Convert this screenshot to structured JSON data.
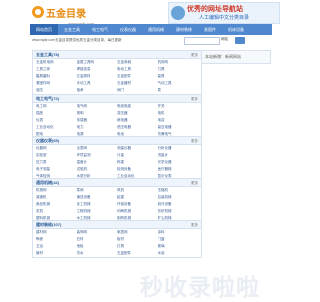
{
  "header": {
    "logo_text": "五金目录",
    "logo_url": "www.wjdir.com"
  },
  "banner": {
    "title": "优秀的网址导航站",
    "subtitle": "人工编辑中文分类目录"
  },
  "nav": {
    "items": [
      "网站首页",
      "五金工具",
      "电工电气",
      "仪表仪器",
      "通用机械",
      "建材装修",
      "紧固件",
      "机床设备"
    ]
  },
  "search": {
    "tip": "www.wjdir.com五金目录提供优质五金分类目录，每日更新",
    "placeholder": "",
    "select_value": "网站",
    "button_label": ""
  },
  "sidebar": {
    "text": "本站新增：新闻网站"
  },
  "sections": [
    {
      "title": "五金工具(78)",
      "more": "更多",
      "links": [
        "五金机电网",
        "金属工具网",
        "五金商城",
        "机床网",
        "工具之家",
        "焊接信息",
        "电动工具",
        "刀具",
        "磨具磨料",
        "五金原材",
        "五金配件",
        "量具",
        "紧固件网",
        "手动工具",
        "五金器材",
        "气动工具",
        "液压",
        "轴承",
        "阀门",
        "泵",
        "密封件",
        "管件",
        "电焊",
        "钳工"
      ]
    },
    {
      "title": "电工电气(72)",
      "more": "更多",
      "links": [
        "电工网",
        "电气网",
        "电线电缆",
        "开关",
        "插座",
        "照明",
        "变压器",
        "电机",
        "仪表",
        "传感器",
        "继电器",
        "电容",
        "工业自动化",
        "电力",
        "低压电器",
        "高压电器",
        "配电",
        "电源",
        "电池",
        "防爆电气"
      ]
    },
    {
      "title": "仪器仪表(65)",
      "more": "更多",
      "links": [
        "仪器网",
        "仪表网",
        "测量仪器",
        "分析仪器",
        "实验室",
        "环境监测",
        "计量",
        "流量计",
        "压力表",
        "温度计",
        "称重",
        "光学仪器",
        "电子测量",
        "试验机",
        "检测设备",
        "医疗器械",
        "气体检测",
        "水质分析",
        "工业自动化",
        "显示仪表"
      ]
    },
    {
      "title": "通用机械(42)",
      "more": "更多",
      "links": [
        "机械网",
        "泵阀",
        "风机",
        "压缩机",
        "减速机",
        "输送设备",
        "起重",
        "包装机械",
        "食品机械",
        "化工机械",
        "环保设备",
        "制冷设备",
        "农机",
        "工程机械",
        "印刷机械",
        "纺织机械",
        "塑料机械",
        "木工机械",
        "制药机械",
        "矿山机械"
      ]
    },
    {
      "title": "建材装修(107)",
      "more": "更多",
      "links": [
        "建材网",
        "装饰网",
        "家居网",
        "涂料",
        "陶瓷",
        "石材",
        "板材",
        "门窗",
        "卫浴",
        "地板",
        "灯具",
        "玻璃",
        "管材",
        "防水",
        "五金配件",
        "水泥"
      ]
    }
  ],
  "watermark": "秒收录啦啦"
}
